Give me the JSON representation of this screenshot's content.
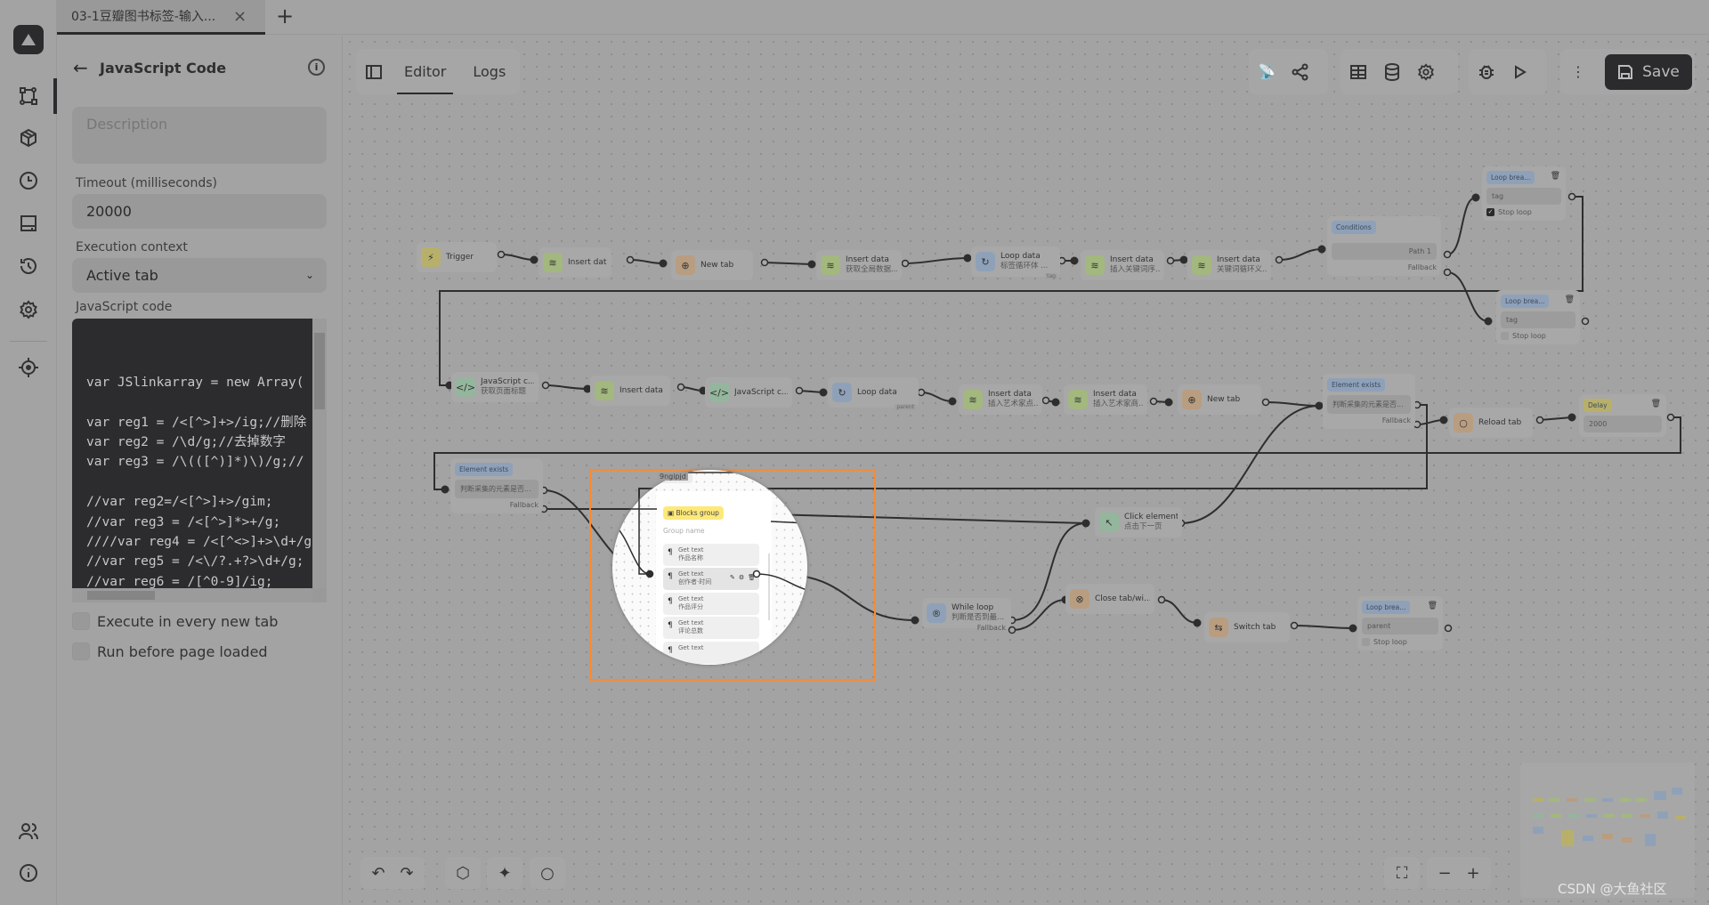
{
  "tab": {
    "label": "03-1豆瓣图书标签-输入...",
    "close": "×",
    "new": "+"
  },
  "sidebar": {
    "items": [
      {
        "icon": "workflow-icon"
      },
      {
        "icon": "package-icon"
      },
      {
        "icon": "clock-icon"
      },
      {
        "icon": "storage-icon"
      },
      {
        "icon": "history-icon"
      },
      {
        "icon": "settings-icon"
      },
      {
        "icon": "crosshair-icon"
      },
      {
        "icon": "team-icon"
      },
      {
        "icon": "about-icon"
      }
    ],
    "active": 0
  },
  "panel": {
    "title": "JavaScript Code",
    "description_placeholder": "Description",
    "timeout_label": "Timeout (milliseconds)",
    "timeout_value": "20000",
    "context_label": "Execution context",
    "context_value": "Active tab",
    "code_label": "JavaScript code",
    "code": "\n\nvar JSlinkarray = new Array(\n\nvar reg1 = /<[^>]+>/ig;//删除\nvar reg2 = /\\d/g;//去掉数字\nvar reg3 = /\\(([^)]*)\\)/g;//\n\n//var reg2=/<[^>]+>/gim;\n//var reg3 = /<[^>]*>+/g;\n////var reg4 = /<[^<>]+>\\d+/g\n//var reg5 = /<\\/?.+?>\\d+/g;\n//var reg6 = /[^0-9]/ig;",
    "checkbox_every_tab": "Execute in every new tab",
    "checkbox_before_load": "Run before page loaded",
    "checkbox_every_tab_checked": false,
    "checkbox_before_load_checked": false
  },
  "editor": {
    "tabs": [
      "Editor",
      "Logs"
    ],
    "active_tab": "Editor",
    "save_label": "Save"
  },
  "nodes": [
    {
      "id": "n1",
      "type": "basic",
      "title": "Trigger",
      "icon": "⚡",
      "color": "#b8b06a"
    },
    {
      "id": "n2",
      "type": "basic",
      "title": "Insert data",
      "icon": "≋",
      "color": "#a3b87e"
    },
    {
      "id": "n3",
      "type": "basic",
      "title": "New tab",
      "icon": "⊕",
      "color": "#b99d80"
    },
    {
      "id": "n4",
      "type": "basic",
      "title": "Insert data",
      "sub": "获取全局数据...",
      "icon": "≋",
      "color": "#a3b87e"
    },
    {
      "id": "n5",
      "type": "basic",
      "title": "Loop data",
      "sub": "标签循环体 ...",
      "tag": "tag",
      "icon": "↻",
      "color": "#8fa1b8"
    },
    {
      "id": "n6",
      "type": "basic",
      "title": "Insert data",
      "sub": "插入关键词序...",
      "icon": "≋",
      "color": "#a3b87e"
    },
    {
      "id": "n7",
      "type": "basic",
      "title": "Insert data",
      "sub": "关键词循环义...",
      "icon": "≋",
      "color": "#a3b87e"
    },
    {
      "id": "n8",
      "type": "conditions",
      "title": "Conditions",
      "path": "Path 1",
      "fallback": "Fallback",
      "color": "#8fa1b8"
    },
    {
      "id": "n9",
      "type": "loopbreak",
      "title": "Loop brea...",
      "value": "tag",
      "stop": "Stop loop",
      "checked": true,
      "color": "#8fa1b8"
    },
    {
      "id": "n10",
      "type": "loopbreak",
      "title": "Loop brea...",
      "value": "tag",
      "stop": "Stop loop",
      "checked": false,
      "color": "#8fa1b8"
    },
    {
      "id": "n11",
      "type": "basic",
      "title": "JavaScript c...",
      "sub": "获取页面标题",
      "icon": "</>",
      "color": "#93b69d"
    },
    {
      "id": "n12",
      "type": "basic",
      "title": "Insert data",
      "icon": "≋",
      "color": "#a3b87e"
    },
    {
      "id": "n13",
      "type": "basic",
      "title": "JavaScript c...",
      "icon": "</>",
      "color": "#93b69d"
    },
    {
      "id": "n14",
      "type": "basic",
      "title": "Loop data",
      "tag": "parent",
      "icon": "↻",
      "color": "#8fa1b8"
    },
    {
      "id": "n15",
      "type": "basic",
      "title": "Insert data",
      "sub": "插入艺术家点...",
      "icon": "≋",
      "color": "#a3b87e"
    },
    {
      "id": "n16",
      "type": "basic",
      "title": "Insert data",
      "sub": "插入艺术家商...",
      "icon": "≋",
      "color": "#a3b87e"
    },
    {
      "id": "n17",
      "type": "basic",
      "title": "New tab",
      "icon": "⊕",
      "color": "#b99d80"
    },
    {
      "id": "n18",
      "type": "exists",
      "title": "Element exists",
      "value": "判断采集的元素是否...",
      "fallback": "Fallback",
      "color": "#8fa1b8"
    },
    {
      "id": "n19",
      "type": "basic",
      "title": "Reload tab",
      "icon": "○",
      "color": "#b99d80"
    },
    {
      "id": "n20",
      "type": "delay",
      "title": "Delay",
      "value": "2000",
      "color": "#b8b06a"
    },
    {
      "id": "n21",
      "type": "exists",
      "title": "Element exists",
      "value": "判断采集的元素是否...",
      "fallback": "Fallback",
      "color": "#8fa1b8"
    },
    {
      "id": "n22",
      "type": "basic",
      "title": "Click element",
      "sub": "点击下一页",
      "icon": "↖",
      "color": "#93b69d"
    },
    {
      "id": "n23",
      "type": "basic",
      "title": "While loop",
      "sub": "判断是否到最...",
      "fallback": "Fallback",
      "icon": "®",
      "color": "#8fa1b8"
    },
    {
      "id": "n24",
      "type": "basic",
      "title": "Close tab/wi...",
      "icon": "⊗",
      "color": "#b99d80"
    },
    {
      "id": "n25",
      "type": "basic",
      "title": "Switch tab",
      "icon": "⇆",
      "color": "#b99d80"
    },
    {
      "id": "n26",
      "type": "loopbreak",
      "title": "Loop brea...",
      "value": "parent",
      "stop": "Stop loop",
      "checked": false,
      "color": "#8fa1b8"
    }
  ],
  "blocks_group": {
    "id": "9ngipjd",
    "title": "Blocks group",
    "name_placeholder": "Group name",
    "items": [
      {
        "title": "Get text",
        "sub": "作品名称"
      },
      {
        "title": "Get text",
        "sub": "创作者·时间"
      },
      {
        "title": "Get text",
        "sub": "作品评分"
      },
      {
        "title": "Get text",
        "sub": "评论总数"
      },
      {
        "title": "Get text",
        "sub": ""
      }
    ]
  },
  "watermark": "CSDN @大鱼社区",
  "colors": {
    "accent": "#2b2b2d",
    "highlight": "#ff8a2b",
    "blocks_group": "#fde97a"
  }
}
